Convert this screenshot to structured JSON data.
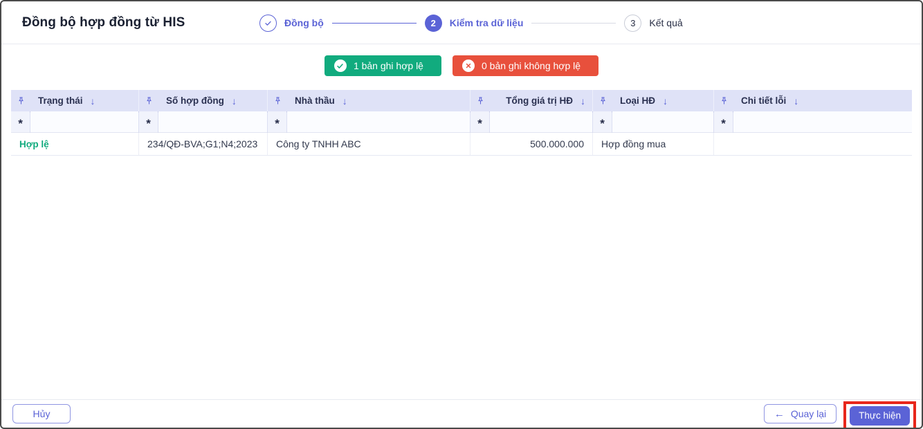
{
  "window": {
    "title": "Đồng bộ hợp đồng từ HIS"
  },
  "stepper": {
    "steps": [
      {
        "label": "Đồng bộ"
      },
      {
        "number": "2",
        "label": "Kiểm tra dữ liệu"
      },
      {
        "number": "3",
        "label": "Kết quả"
      }
    ]
  },
  "summary": {
    "valid": "1 bản ghi hợp lệ",
    "invalid": "0 bản ghi không hợp lệ"
  },
  "table": {
    "sort_icon": "↓",
    "filter_symbol": "*",
    "columns": [
      {
        "label": "Trạng thái"
      },
      {
        "label": "Số hợp đồng"
      },
      {
        "label": "Nhà thầu"
      },
      {
        "label": "Tổng giá trị HĐ"
      },
      {
        "label": "Loại HĐ"
      },
      {
        "label": "Chi tiết lỗi"
      }
    ],
    "rows": [
      {
        "status": "Hợp lệ",
        "contract_number": "234/QĐ-BVA;G1;N4;2023",
        "contractor": "Công ty TNHH ABC",
        "total_value": "500.000.000",
        "contract_type": "Hợp đồng mua",
        "error_detail": ""
      }
    ]
  },
  "footer": {
    "cancel": "Hủy",
    "back_arrow": "←",
    "back": "Quay lại",
    "submit": "Thực hiện"
  },
  "colors": {
    "primary": "#5b63d6",
    "success": "#11ab7e",
    "danger": "#e8503c",
    "annotation": "#e8261b",
    "header_bg": "#dfe2f7"
  }
}
